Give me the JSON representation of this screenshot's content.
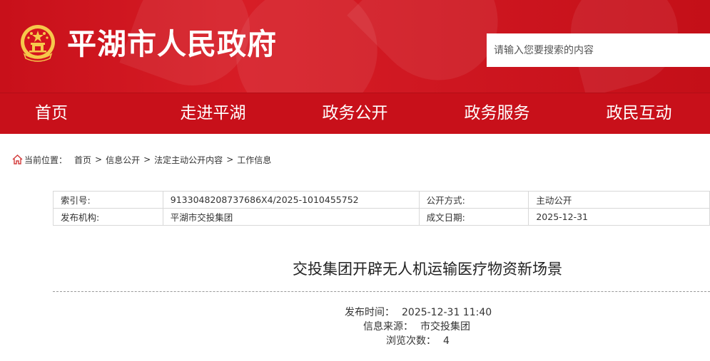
{
  "header": {
    "site_title": "平湖市人民政府",
    "emblem_icon": "national-emblem-icon",
    "search": {
      "placeholder": "请输入您要搜索的内容"
    }
  },
  "nav": {
    "items": [
      {
        "label": "首页"
      },
      {
        "label": "走进平湖"
      },
      {
        "label": "政务公开"
      },
      {
        "label": "政务服务"
      },
      {
        "label": "政民互动"
      }
    ]
  },
  "breadcrumb": {
    "icon": "home-icon",
    "label": "当前位置：",
    "items": [
      {
        "label": "首页"
      },
      {
        "label": "信息公开"
      },
      {
        "label": "法定主动公开内容"
      },
      {
        "label": "工作信息"
      }
    ],
    "separator": ">"
  },
  "meta": {
    "index_label": "索引号:",
    "index_value": "913304820873768​6X4/2025-1010455752",
    "open_method_label": "公开方式:",
    "open_method_value": "主动公开",
    "publisher_label": "发布机构:",
    "publisher_value": "平湖市交投集团",
    "date_label": "成文日期:",
    "date_value": "2025-12-31"
  },
  "article": {
    "title": "交投集团开辟无人机运输医疗物资新场景",
    "publish_time_label": "发布时间：",
    "publish_time_value": "2025-12-31 11:40",
    "source_label": "信息来源：",
    "source_value": "市交投集团",
    "views_label": "浏览次数：",
    "views_value": "4"
  },
  "colors": {
    "brand_red": "#c8101a",
    "gold": "#f6c84b"
  }
}
